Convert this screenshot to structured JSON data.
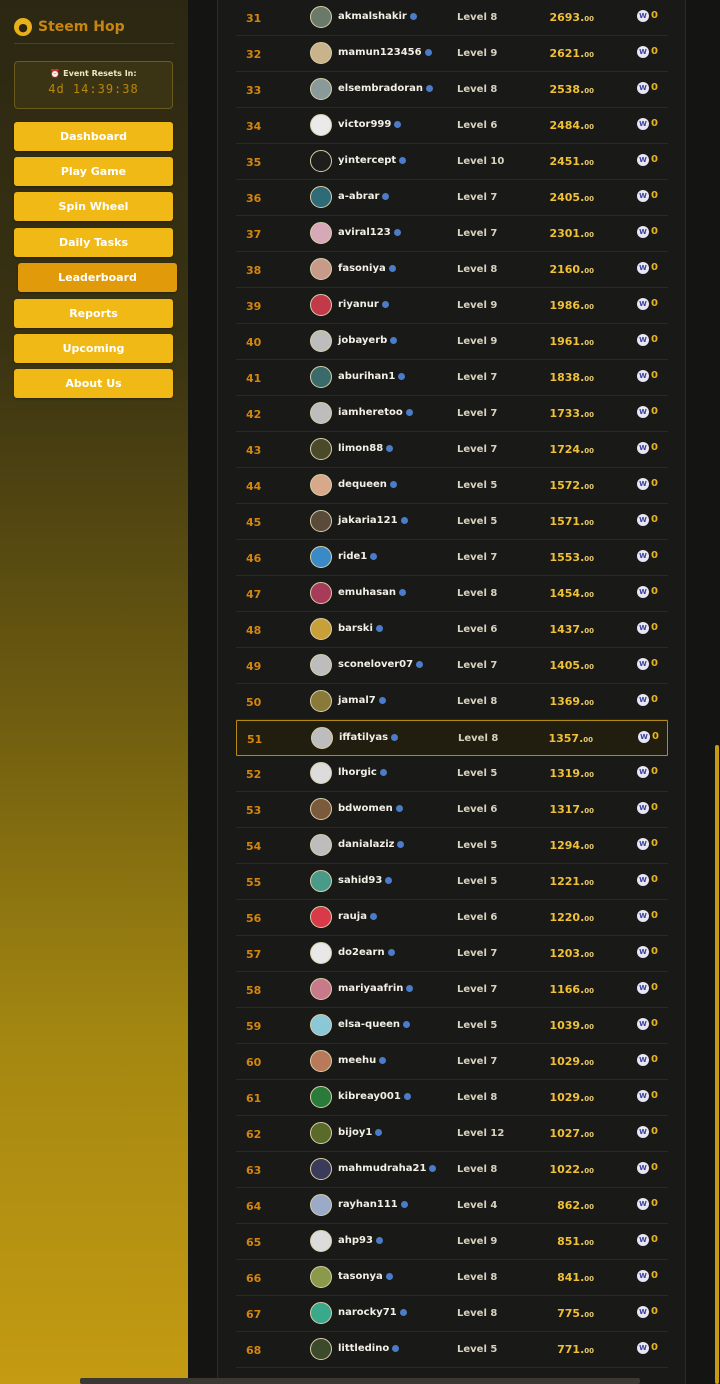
{
  "app": {
    "title": "Steem Hop",
    "logo_icon": "hop-logo-icon"
  },
  "event": {
    "label": "⏰ Event Resets In:",
    "time": "4d 14:39:38"
  },
  "nav": [
    {
      "label": "Dashboard",
      "active": false
    },
    {
      "label": "Play Game",
      "active": false
    },
    {
      "label": "Spin Wheel",
      "active": false
    },
    {
      "label": "Daily Tasks",
      "active": false
    },
    {
      "label": "Leaderboard",
      "active": true
    },
    {
      "label": "Reports",
      "active": false
    },
    {
      "label": "Upcoming",
      "active": false
    },
    {
      "label": "About Us",
      "active": false
    }
  ],
  "colors": {
    "accent": "#f0b916",
    "active": "#e09a0a",
    "rank": "#d4860c",
    "score": "#f0c037"
  },
  "leaderboard": {
    "highlight_rank": "51",
    "rows": [
      {
        "rank": "31",
        "user": "akmalshakir",
        "level": "Level 8",
        "score": "2693.",
        "decimal": "00",
        "reward": "0",
        "avatar": "#6a7a6a"
      },
      {
        "rank": "32",
        "user": "mamun123456",
        "level": "Level 9",
        "score": "2621.",
        "decimal": "00",
        "reward": "0",
        "avatar": "#c9b38a"
      },
      {
        "rank": "33",
        "user": "elsembradoran",
        "level": "Level 8",
        "score": "2538.",
        "decimal": "00",
        "reward": "0",
        "avatar": "#8a9a9a"
      },
      {
        "rank": "34",
        "user": "victor999",
        "level": "Level 6",
        "score": "2484.",
        "decimal": "00",
        "reward": "0",
        "avatar": "#eaeaea"
      },
      {
        "rank": "35",
        "user": "yintercept",
        "level": "Level 10",
        "score": "2451.",
        "decimal": "00",
        "reward": "0",
        "avatar": "#1e1e1c"
      },
      {
        "rank": "36",
        "user": "a-abrar",
        "level": "Level 7",
        "score": "2405.",
        "decimal": "00",
        "reward": "0",
        "avatar": "#2f6a78"
      },
      {
        "rank": "37",
        "user": "aviral123",
        "level": "Level 7",
        "score": "2301.",
        "decimal": "00",
        "reward": "0",
        "avatar": "#d6a8b8"
      },
      {
        "rank": "38",
        "user": "fasoniya",
        "level": "Level 8",
        "score": "2160.",
        "decimal": "00",
        "reward": "0",
        "avatar": "#c89a8a"
      },
      {
        "rank": "39",
        "user": "riyanur",
        "level": "Level 9",
        "score": "1986.",
        "decimal": "00",
        "reward": "0",
        "avatar": "#c23a4a"
      },
      {
        "rank": "40",
        "user": "jobayerb",
        "level": "Level 9",
        "score": "1961.",
        "decimal": "00",
        "reward": "0",
        "avatar": "#bdbdbd"
      },
      {
        "rank": "41",
        "user": "aburihan1",
        "level": "Level 7",
        "score": "1838.",
        "decimal": "00",
        "reward": "0",
        "avatar": "#3a6a6a"
      },
      {
        "rank": "42",
        "user": "iamheretoo",
        "level": "Level 7",
        "score": "1733.",
        "decimal": "00",
        "reward": "0",
        "avatar": "#bdbdbd"
      },
      {
        "rank": "43",
        "user": "limon88",
        "level": "Level 7",
        "score": "1724.",
        "decimal": "00",
        "reward": "0",
        "avatar": "#4a4a2a"
      },
      {
        "rank": "44",
        "user": "dequeen",
        "level": "Level 5",
        "score": "1572.",
        "decimal": "00",
        "reward": "0",
        "avatar": "#d8a88a"
      },
      {
        "rank": "45",
        "user": "jakaria121",
        "level": "Level 5",
        "score": "1571.",
        "decimal": "00",
        "reward": "0",
        "avatar": "#5a4a3a"
      },
      {
        "rank": "46",
        "user": "ride1",
        "level": "Level 7",
        "score": "1553.",
        "decimal": "00",
        "reward": "0",
        "avatar": "#3a8ac8"
      },
      {
        "rank": "47",
        "user": "emuhasan",
        "level": "Level 8",
        "score": "1454.",
        "decimal": "00",
        "reward": "0",
        "avatar": "#a83a5a"
      },
      {
        "rank": "48",
        "user": "barski",
        "level": "Level 6",
        "score": "1437.",
        "decimal": "00",
        "reward": "0",
        "avatar": "#c8a03a"
      },
      {
        "rank": "49",
        "user": "sconelover07",
        "level": "Level 7",
        "score": "1405.",
        "decimal": "00",
        "reward": "0",
        "avatar": "#bdbdbd"
      },
      {
        "rank": "50",
        "user": "jamal7",
        "level": "Level 8",
        "score": "1369.",
        "decimal": "00",
        "reward": "0",
        "avatar": "#8a7a3a"
      },
      {
        "rank": "51",
        "user": "iffatilyas",
        "level": "Level 8",
        "score": "1357.",
        "decimal": "00",
        "reward": "0",
        "avatar": "#bdbdbd"
      },
      {
        "rank": "52",
        "user": "lhorgic",
        "level": "Level 5",
        "score": "1319.",
        "decimal": "00",
        "reward": "0",
        "avatar": "#dcdcdc"
      },
      {
        "rank": "53",
        "user": "bdwomen",
        "level": "Level 6",
        "score": "1317.",
        "decimal": "00",
        "reward": "0",
        "avatar": "#7a5a3a"
      },
      {
        "rank": "54",
        "user": "danialaziz",
        "level": "Level 5",
        "score": "1294.",
        "decimal": "00",
        "reward": "0",
        "avatar": "#bdbdbd"
      },
      {
        "rank": "55",
        "user": "sahid93",
        "level": "Level 5",
        "score": "1221.",
        "decimal": "00",
        "reward": "0",
        "avatar": "#4a9a8a"
      },
      {
        "rank": "56",
        "user": "rauja",
        "level": "Level 6",
        "score": "1220.",
        "decimal": "00",
        "reward": "0",
        "avatar": "#d83a4a"
      },
      {
        "rank": "57",
        "user": "do2earn",
        "level": "Level 7",
        "score": "1203.",
        "decimal": "00",
        "reward": "0",
        "avatar": "#e8e8e8"
      },
      {
        "rank": "58",
        "user": "mariyaafrin",
        "level": "Level 7",
        "score": "1166.",
        "decimal": "00",
        "reward": "0",
        "avatar": "#c87a8a"
      },
      {
        "rank": "59",
        "user": "elsa-queen",
        "level": "Level 5",
        "score": "1039.",
        "decimal": "00",
        "reward": "0",
        "avatar": "#8ac8d8"
      },
      {
        "rank": "60",
        "user": "meehu",
        "level": "Level 7",
        "score": "1029.",
        "decimal": "00",
        "reward": "0",
        "avatar": "#b87a5a"
      },
      {
        "rank": "61",
        "user": "kibreay001",
        "level": "Level 8",
        "score": "1029.",
        "decimal": "00",
        "reward": "0",
        "avatar": "#2a7a3a"
      },
      {
        "rank": "62",
        "user": "bijoy1",
        "level": "Level 12",
        "score": "1027.",
        "decimal": "00",
        "reward": "0",
        "avatar": "#5a6a2a"
      },
      {
        "rank": "63",
        "user": "mahmudraha21",
        "level": "Level 8",
        "score": "1022.",
        "decimal": "00",
        "reward": "0",
        "avatar": "#3a3a5a"
      },
      {
        "rank": "64",
        "user": "rayhan111",
        "level": "Level 4",
        "score": "862.",
        "decimal": "00",
        "reward": "0",
        "avatar": "#9aaac8"
      },
      {
        "rank": "65",
        "user": "ahp93",
        "level": "Level 9",
        "score": "851.",
        "decimal": "00",
        "reward": "0",
        "avatar": "#dcdcdc"
      },
      {
        "rank": "66",
        "user": "tasonya",
        "level": "Level 8",
        "score": "841.",
        "decimal": "00",
        "reward": "0",
        "avatar": "#8a9a4a"
      },
      {
        "rank": "67",
        "user": "narocky71",
        "level": "Level 8",
        "score": "775.",
        "decimal": "00",
        "reward": "0",
        "avatar": "#3aa88a"
      },
      {
        "rank": "68",
        "user": "littledino",
        "level": "Level 5",
        "score": "771.",
        "decimal": "00",
        "reward": "0",
        "avatar": "#3a4a2a"
      }
    ]
  }
}
